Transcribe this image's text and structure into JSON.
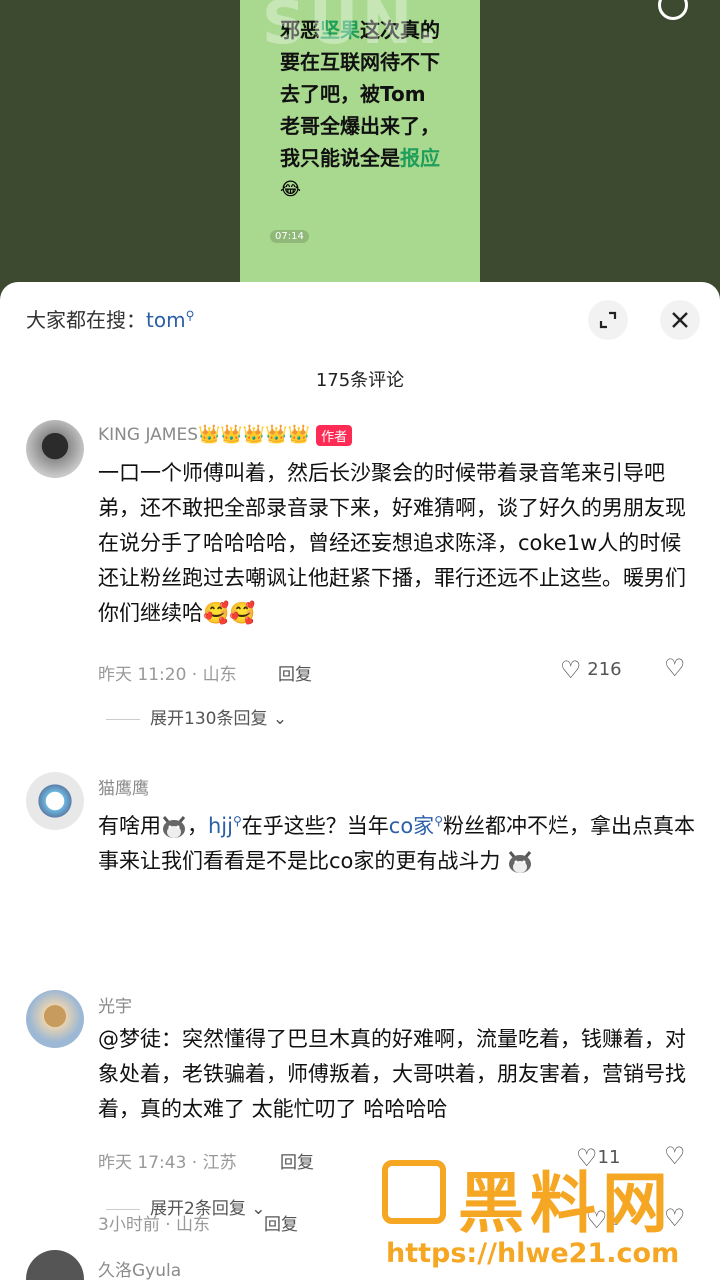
{
  "video": {
    "watermark": "SUN.",
    "lines": [
      {
        "pre": "邪恶",
        "hl": "坚果",
        "post": "这次真的"
      },
      {
        "pre": "要在互联网待不下",
        "hl": "",
        "post": ""
      },
      {
        "pre": "去了吧，被Tom",
        "hl": "",
        "post": ""
      },
      {
        "pre": "老哥全爆出来了，",
        "hl": "",
        "post": ""
      },
      {
        "pre": "我只能说全是",
        "hl": "报应",
        "post": ""
      }
    ],
    "emoji": "😂",
    "time": "07:14"
  },
  "search": {
    "prefix": "大家都在搜：",
    "keyword": "tom"
  },
  "header": {
    "count_label": "175条评论"
  },
  "comments": [
    {
      "user": "KING JAMES",
      "crowns": "👑👑👑👑👑",
      "tag": "作者",
      "text": "一口一个师傅叫着，然后长沙聚会的时候带着录音笔来引导吧弟，还不敢把全部录音录下来，好难猜啊，谈了好久的男朋友现在说分手了哈哈哈哈，曾经还妄想追求陈泽，coke1w人的时候还让粉丝跑过去嘲讽让他赶紧下播，罪行还远不止这些。暖男们你们继续哈🥰🥰",
      "time_loc": "昨天 11:20 · 山东",
      "reply_label": "回复",
      "likes": "216",
      "expand_label": "展开130条回复"
    },
    {
      "user": "猫鹰鹰",
      "text_parts": [
        "有啥用",
        "，",
        "hjj",
        "在乎这些？当年",
        "co家",
        "粉丝都冲不烂，拿出点真本事来让我们看看是不是比co家的更有战斗力"
      ],
      "time_loc": "3小时前 · 山东",
      "reply_label": "回复",
      "likes": "1"
    },
    {
      "user": "光宇",
      "text": "@梦徒：突然懂得了巴旦木真的好难啊，流量吃着，钱赚着，对象处着，老铁骗着，师傅叛着，大哥哄着，朋友害着，营销号找着，真的太难了 太能忙叨了 哈哈哈哈",
      "time_loc": "昨天 17:43 · 江苏",
      "reply_label": "回复",
      "likes": "11",
      "expand_label": "展开2条回复"
    },
    {
      "user": "久洛Gyula"
    }
  ],
  "watermark_logo": {
    "title": "黑料网",
    "url": "https://hlwe21.com"
  },
  "colors": {
    "brand_red": "#fe2c55",
    "link_blue": "#2b5fa8",
    "watermark_orange": "#f5a623"
  }
}
